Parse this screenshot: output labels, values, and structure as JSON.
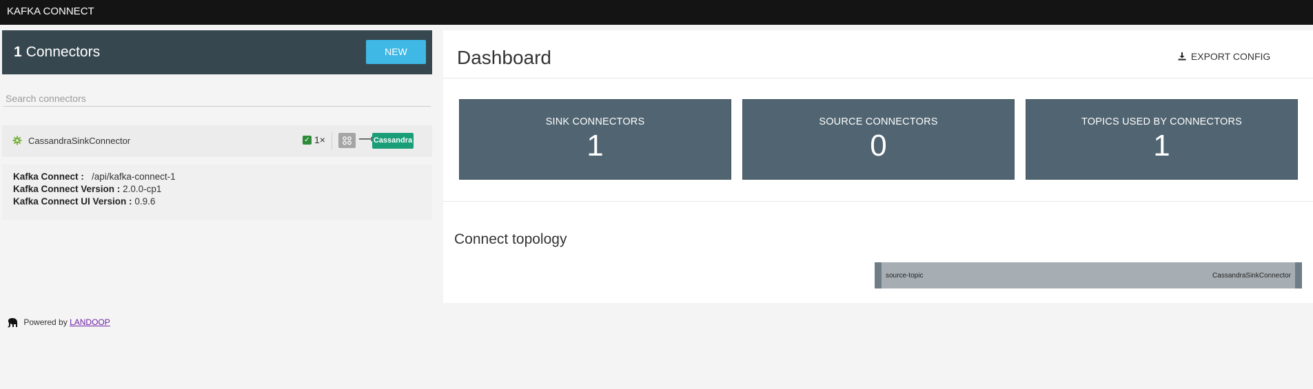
{
  "app": {
    "title": "KAFKA CONNECT"
  },
  "sidebar": {
    "count": "1",
    "count_label": "Connectors",
    "new_button": "NEW",
    "search_placeholder": "Search connectors",
    "connectors": [
      {
        "name": "CassandraSinkConnector",
        "tasks": "1×",
        "sink": "Cassandra"
      }
    ],
    "info": {
      "connect_label": "Kafka Connect :",
      "connect_value": "/api/kafka-connect-1",
      "version_label": "Kafka Connect Version :",
      "version_value": "2.0.0-cp1",
      "ui_version_label": "Kafka Connect UI Version :",
      "ui_version_value": "0.9.6"
    }
  },
  "footer": {
    "powered_by": "Powered by",
    "link": "LANDOOP"
  },
  "main": {
    "title": "Dashboard",
    "export": "EXPORT CONFIG",
    "cards": [
      {
        "label": "SINK CONNECTORS",
        "value": "1"
      },
      {
        "label": "SOURCE CONNECTORS",
        "value": "0"
      },
      {
        "label": "TOPICS USED BY CONNECTORS",
        "value": "1"
      }
    ],
    "topology": {
      "title": "Connect topology",
      "source": "source-topic",
      "target": "CassandraSinkConnector"
    }
  },
  "colors": {
    "topbar": "#141414",
    "header": "#37474f",
    "new_button": "#3fb8e5",
    "card": "#506471",
    "sink_badge": "#1a9e78",
    "link": "#6f1ea8"
  }
}
